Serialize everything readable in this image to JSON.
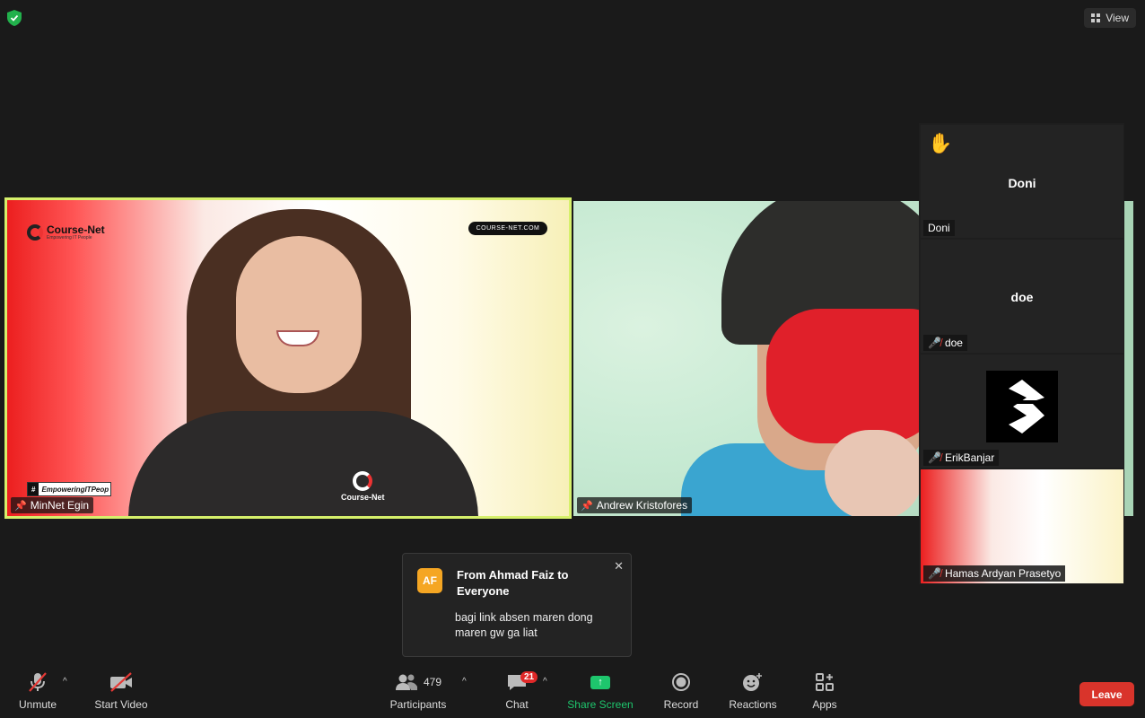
{
  "header": {
    "view_label": "View"
  },
  "tiles": {
    "main": {
      "name": "MinNet Egin",
      "logo_text": "Course-Net",
      "logo_sub": "Empowering IT People",
      "url_pill": "COURSE-NET.COM",
      "hashtag": "EmpoweringITPeop",
      "shirt_logo": "Course-Net"
    },
    "second": {
      "name": "Andrew Kristofores"
    }
  },
  "side_panel": {
    "doni": {
      "big_name": "Doni",
      "tag": "Doni"
    },
    "doe": {
      "big_name": "doe",
      "tag": "doe"
    },
    "erik": {
      "tag": "ErikBanjar"
    },
    "hamas": {
      "tag": "Hamas Ardyan Prasetyo"
    }
  },
  "chat_notification": {
    "avatar": "AF",
    "from": "From Ahmad Faiz to Everyone",
    "message": "bagi link absen maren dong maren gw ga liat"
  },
  "toolbar": {
    "unmute": "Unmute",
    "start_video": "Start Video",
    "participants": "Participants",
    "participants_count": "479",
    "chat": "Chat",
    "chat_badge": "21",
    "share_screen": "Share Screen",
    "record": "Record",
    "reactions": "Reactions",
    "apps": "Apps",
    "leave": "Leave"
  },
  "colors": {
    "active_speaker_border": "#d6f06b",
    "share_screen": "#1ec66d",
    "leave": "#d9342b",
    "badge": "#e02828",
    "avatar": "#f5a623"
  }
}
